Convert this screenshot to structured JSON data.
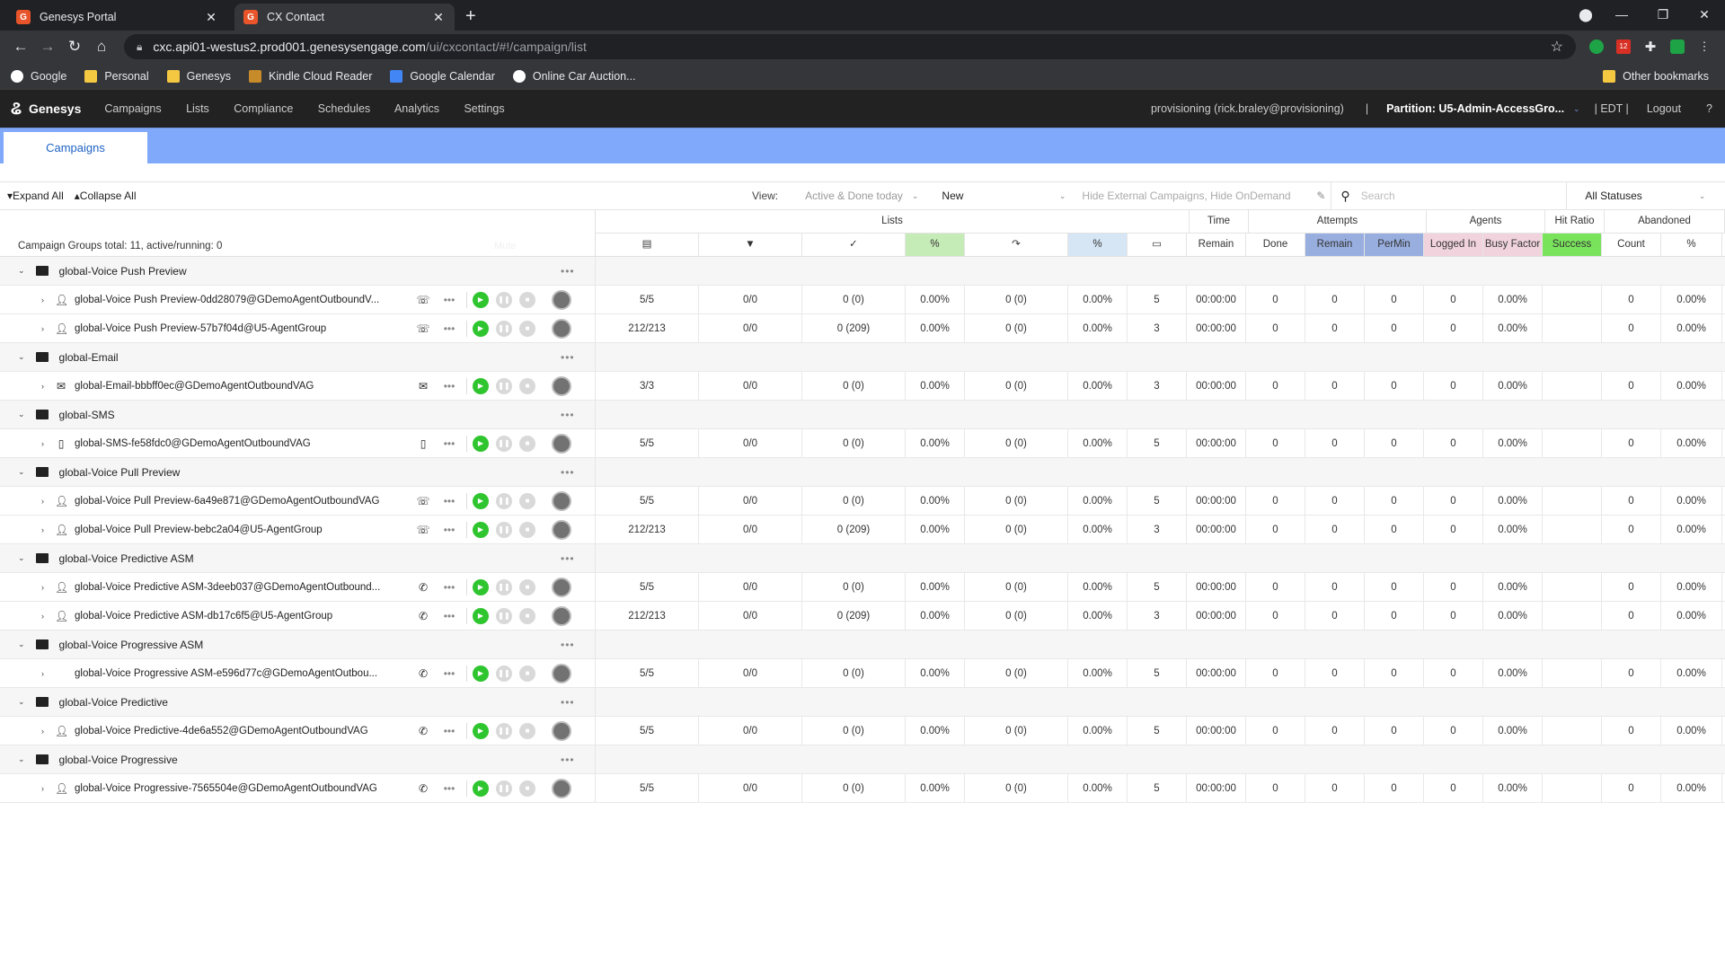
{
  "browser": {
    "tabs": [
      {
        "title": "Genesys Portal",
        "active": false
      },
      {
        "title": "CX Contact",
        "active": true
      }
    ],
    "url_host": "cxc.api01-westus2.prod001.genesysengage.com",
    "url_path": "/ui/cxcontact/#!/campaign/list",
    "bookmarks": [
      "Google",
      "Personal",
      "Genesys",
      "Kindle Cloud Reader",
      "Google Calendar",
      "Online Car Auction..."
    ],
    "other_bookmarks": "Other bookmarks",
    "ext_badge": "12"
  },
  "app": {
    "brand": "Genesys",
    "nav": [
      "Campaigns",
      "Lists",
      "Compliance",
      "Schedules",
      "Analytics",
      "Settings"
    ],
    "user": "provisioning (rick.braley@provisioning)",
    "partition": "Partition: U5-Admin-AccessGro...",
    "timezone": "| EDT |",
    "logout": "Logout",
    "help": "?",
    "campaigns_tab": "Campaigns"
  },
  "toolbar": {
    "expand_all": "Expand All",
    "collapse_all": "Collapse All",
    "view_label": "View:",
    "view_value": "Active & Done today",
    "new_label": "New",
    "filter_text": "Hide External Campaigns, Hide OnDemand",
    "search_placeholder": "Search",
    "status_value": "All Statuses"
  },
  "grid": {
    "summary": "Campaign Groups total: 11, active/running: 0",
    "mute_label": "Mute",
    "top_headers": {
      "lists": "Lists",
      "time": "Time",
      "attempts": "Attempts",
      "agents": "Agents",
      "hit_ratio": "Hit Ratio",
      "abandoned": "Abandoned"
    },
    "sub_headers": [
      "%",
      "%",
      "Remain",
      "Done",
      "Remain",
      "PerMin",
      "Logged In",
      "Busy Factor",
      "Success",
      "Count",
      "%"
    ],
    "colors": {
      "green": "#c5ebb6",
      "lightblue": "#d6e6f5",
      "blue": "#98aedf",
      "pink": "#f1d3dd",
      "success": "#7ae35c"
    }
  },
  "groups": [
    {
      "name": "global-Voice Push Preview",
      "campaigns": [
        {
          "name": "global-Voice Push Preview-0dd28079@GDemoAgentOutboundV...",
          "icon": "agent-icon",
          "type": "push-preview-icon",
          "v": [
            "5/5",
            "0/0",
            "0 (0)",
            "0.00%",
            "0 (0)",
            "0.00%",
            "5",
            "00:00:00",
            "0",
            "0",
            "0",
            "0",
            "0.00%",
            "",
            "0",
            "0.00%"
          ]
        },
        {
          "name": "global-Voice Push Preview-57b7f04d@U5-AgentGroup",
          "icon": "agent-icon",
          "type": "push-preview-icon",
          "v": [
            "212/213",
            "0/0",
            "0 (209)",
            "0.00%",
            "0 (0)",
            "0.00%",
            "3",
            "00:00:00",
            "0",
            "0",
            "0",
            "0",
            "0.00%",
            "",
            "0",
            "0.00%"
          ]
        }
      ]
    },
    {
      "name": "global-Email",
      "campaigns": [
        {
          "name": "global-Email-bbbff0ec@GDemoAgentOutboundVAG",
          "icon": "email-icon",
          "type": "email-icon",
          "v": [
            "3/3",
            "0/0",
            "0 (0)",
            "0.00%",
            "0 (0)",
            "0.00%",
            "3",
            "00:00:00",
            "0",
            "0",
            "0",
            "0",
            "0.00%",
            "",
            "0",
            "0.00%"
          ]
        }
      ]
    },
    {
      "name": "global-SMS",
      "campaigns": [
        {
          "name": "global-SMS-fe58fdc0@GDemoAgentOutboundVAG",
          "icon": "sms-icon",
          "type": "sms-icon",
          "v": [
            "5/5",
            "0/0",
            "0 (0)",
            "0.00%",
            "0 (0)",
            "0.00%",
            "5",
            "00:00:00",
            "0",
            "0",
            "0",
            "0",
            "0.00%",
            "",
            "0",
            "0.00%"
          ]
        }
      ]
    },
    {
      "name": "global-Voice Pull Preview",
      "campaigns": [
        {
          "name": "global-Voice Pull Preview-6a49e871@GDemoAgentOutboundVAG",
          "icon": "agent-icon",
          "type": "pull-preview-icon",
          "v": [
            "5/5",
            "0/0",
            "0 (0)",
            "0.00%",
            "0 (0)",
            "0.00%",
            "5",
            "00:00:00",
            "0",
            "0",
            "0",
            "0",
            "0.00%",
            "",
            "0",
            "0.00%"
          ]
        },
        {
          "name": "global-Voice Pull Preview-bebc2a04@U5-AgentGroup",
          "icon": "agent-icon",
          "type": "pull-preview-icon",
          "v": [
            "212/213",
            "0/0",
            "0 (209)",
            "0.00%",
            "0 (0)",
            "0.00%",
            "3",
            "00:00:00",
            "0",
            "0",
            "0",
            "0",
            "0.00%",
            "",
            "0",
            "0.00%"
          ]
        }
      ]
    },
    {
      "name": "global-Voice Predictive ASM",
      "campaigns": [
        {
          "name": "global-Voice Predictive ASM-3deeb037@GDemoAgentOutbound...",
          "icon": "agent-icon",
          "type": "phone-icon",
          "v": [
            "5/5",
            "0/0",
            "0 (0)",
            "0.00%",
            "0 (0)",
            "0.00%",
            "5",
            "00:00:00",
            "0",
            "0",
            "0",
            "0",
            "0.00%",
            "",
            "0",
            "0.00%"
          ]
        },
        {
          "name": "global-Voice Predictive ASM-db17c6f5@U5-AgentGroup",
          "icon": "agent-icon",
          "type": "phone-icon",
          "v": [
            "212/213",
            "0/0",
            "0 (209)",
            "0.00%",
            "0 (0)",
            "0.00%",
            "3",
            "00:00:00",
            "0",
            "0",
            "0",
            "0",
            "0.00%",
            "",
            "0",
            "0.00%"
          ]
        }
      ]
    },
    {
      "name": "global-Voice Progressive ASM",
      "campaigns": [
        {
          "name": "global-Voice Progressive ASM-e596d77c@GDemoAgentOutbou...",
          "icon": "",
          "type": "phone-icon",
          "v": [
            "5/5",
            "0/0",
            "0 (0)",
            "0.00%",
            "0 (0)",
            "0.00%",
            "5",
            "00:00:00",
            "0",
            "0",
            "0",
            "0",
            "0.00%",
            "",
            "0",
            "0.00%"
          ]
        }
      ]
    },
    {
      "name": "global-Voice Predictive",
      "campaigns": [
        {
          "name": "global-Voice Predictive-4de6a552@GDemoAgentOutboundVAG",
          "icon": "agent-icon",
          "type": "phone-icon",
          "v": [
            "5/5",
            "0/0",
            "0 (0)",
            "0.00%",
            "0 (0)",
            "0.00%",
            "5",
            "00:00:00",
            "0",
            "0",
            "0",
            "0",
            "0.00%",
            "",
            "0",
            "0.00%"
          ]
        }
      ]
    },
    {
      "name": "global-Voice Progressive",
      "campaigns": [
        {
          "name": "global-Voice Progressive-7565504e@GDemoAgentOutboundVAG",
          "icon": "agent-icon",
          "type": "phone-icon",
          "v": [
            "5/5",
            "0/0",
            "0 (0)",
            "0.00%",
            "0 (0)",
            "0.00%",
            "5",
            "00:00:00",
            "0",
            "0",
            "0",
            "0",
            "0.00%",
            "",
            "0",
            "0.00%"
          ]
        }
      ]
    }
  ]
}
